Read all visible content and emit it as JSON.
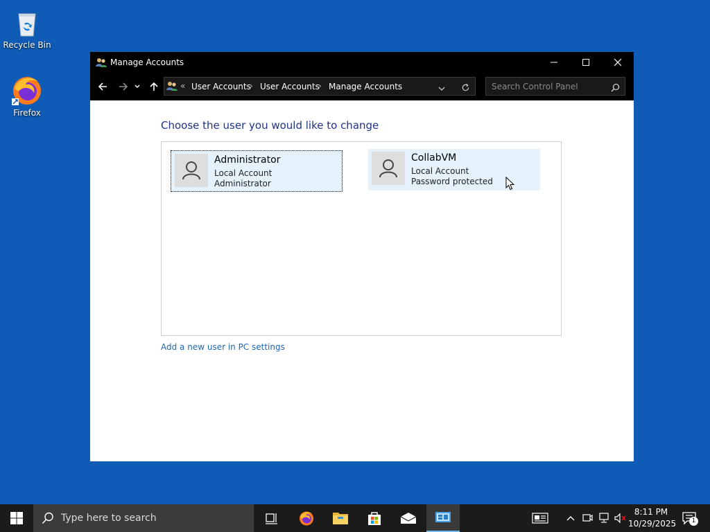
{
  "desktop": {
    "icons": [
      {
        "label": "Recycle Bin",
        "icon": "recycle-bin-icon"
      },
      {
        "label": "Firefox",
        "icon": "firefox-icon"
      }
    ]
  },
  "window": {
    "title": "Manage Accounts",
    "controls": {
      "minimize": "minimize",
      "maximize": "maximize",
      "close": "close"
    },
    "address": {
      "overflow": "«",
      "crumbs": [
        "User Accounts",
        "User Accounts",
        "Manage Accounts"
      ],
      "separator": "›"
    },
    "search": {
      "placeholder": "Search Control Panel"
    },
    "heading": "Choose the user you would like to change",
    "accounts": [
      {
        "name": "Administrator",
        "line1": "Local Account",
        "line2": "Administrator",
        "focused": true
      },
      {
        "name": "CollabVM",
        "line1": "Local Account",
        "line2": "Password protected",
        "focused": false
      }
    ],
    "add_user_link": "Add a new user in PC settings"
  },
  "taskbar": {
    "search_placeholder": "Type here to search",
    "apps": [
      "task-view-icon",
      "firefox-icon",
      "file-explorer-icon",
      "microsoft-store-icon",
      "mail-icon",
      "control-panel-icon"
    ],
    "active_app": "control-panel-icon",
    "clock": {
      "time": "8:11 PM",
      "date": "10/29/2025"
    },
    "notification_count": "1"
  },
  "colors": {
    "desktop": "#0f5bb5",
    "titlebar": "#000000",
    "heading": "#1e3287",
    "link": "#1f66b5",
    "account_tile": "#e5f1fb",
    "taskbar": "#1b1b1b"
  }
}
